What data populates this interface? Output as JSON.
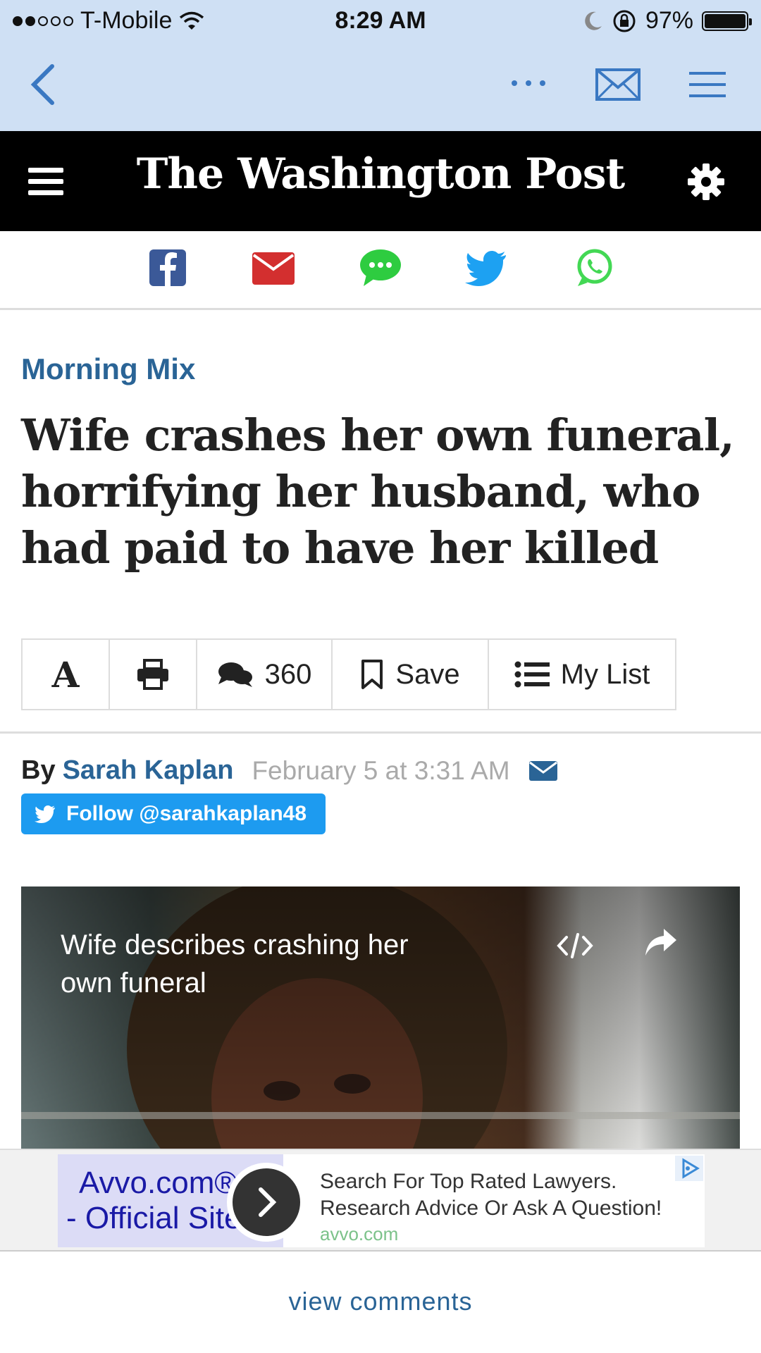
{
  "status_bar": {
    "carrier": "T-Mobile",
    "time": "8:29 AM",
    "battery": "97%"
  },
  "header": {
    "logo": "The Washington Post"
  },
  "share": {
    "icons": [
      "facebook-icon",
      "email-icon",
      "sms-icon",
      "twitter-icon",
      "whatsapp-icon"
    ],
    "colors": {
      "facebook": "#3b5998",
      "email": "#d32f2f",
      "sms": "#2ecc40",
      "twitter": "#1da1f2",
      "whatsapp": "#43d854"
    }
  },
  "article": {
    "kicker": "Morning Mix",
    "headline": "Wife crashes her own funeral, horrifying her husband, who had paid to have her killed",
    "toolbar": {
      "font": "A",
      "comments_count": "360",
      "save_label": "Save",
      "mylist_label": "My List"
    },
    "byline": {
      "by": "By",
      "author": "Sarah Kaplan",
      "date": "February 5 at 3:31 AM"
    },
    "follow_label": "Follow @sarahkaplan48"
  },
  "video": {
    "title": "Wife describes crashing her own funeral"
  },
  "ad": {
    "brand_line1": "Avvo.com®",
    "brand_line2": "- Official Site",
    "desc_line1": "Search For Top Rated Lawyers.",
    "desc_line2": "Research Advice Or Ask A Question!",
    "domain": "avvo.com"
  },
  "footer": {
    "view_comments": "view comments"
  },
  "colors": {
    "chrome_bg": "#cfe0f4",
    "accent_blue": "#2a6496",
    "twitter_blue": "#1d9bf0"
  }
}
